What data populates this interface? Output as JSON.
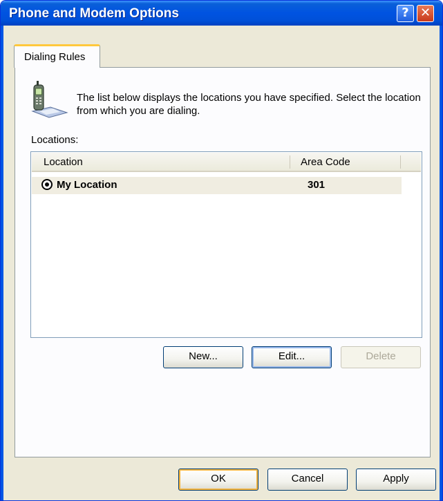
{
  "window": {
    "title": "Phone and Modem Options",
    "help_label": "?",
    "close_label": "✕"
  },
  "tabs": [
    {
      "label": "Dialing Rules",
      "selected": true
    }
  ],
  "dialing_rules": {
    "description": "The list below displays the locations you have specified. Select the location from which you are dialing.",
    "locations_label": "Locations:",
    "columns": [
      "Location",
      "Area Code"
    ],
    "rows": [
      {
        "location": "My Location",
        "area_code": "301",
        "selected": true
      }
    ],
    "new_label": "New...",
    "edit_label": "Edit...",
    "delete_label": "Delete"
  },
  "footer": {
    "ok_label": "OK",
    "cancel_label": "Cancel",
    "apply_label": "Apply"
  },
  "icons": {
    "dialing": "phone-icon",
    "row_marker": "radio-selected-icon"
  }
}
